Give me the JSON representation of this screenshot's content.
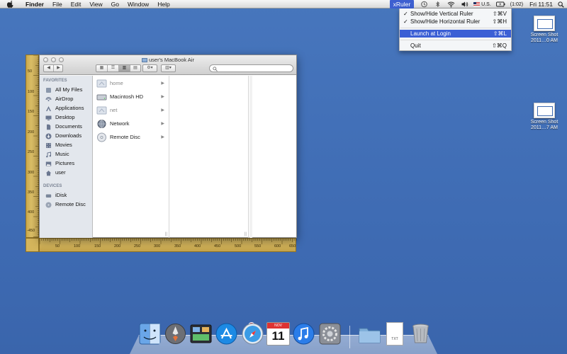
{
  "menubar": {
    "app_name": "Finder",
    "items": [
      "File",
      "Edit",
      "View",
      "Go",
      "Window",
      "Help"
    ],
    "status": {
      "xruler_label": "xRuler",
      "input_source": "U.S.",
      "battery": "(1:02)",
      "clock": "Fri 11:51"
    }
  },
  "xruler_menu": {
    "items": [
      {
        "label": "Show/Hide Vertical Ruler",
        "shortcut": "⇧⌘V",
        "checked": true
      },
      {
        "label": "Show/Hide Horizontal Ruler",
        "shortcut": "⇧⌘H",
        "checked": true
      },
      {
        "label": "Launch at Login",
        "shortcut": "⇧⌘L",
        "highlighted": true
      },
      {
        "label": "Quit",
        "shortcut": "⇧⌘Q"
      }
    ],
    "check_glyph": "✓"
  },
  "desktop_icons": [
    {
      "label_line1": "Screen Shot",
      "label_line2": "2011…0 AM"
    },
    {
      "label_line1": "Screen Shot",
      "label_line2": "2011…7 AM"
    }
  ],
  "vertical_ruler": {
    "labels": [
      "50",
      "100",
      "150",
      "200",
      "250",
      "300",
      "350",
      "400",
      "-450"
    ]
  },
  "horizontal_ruler": {
    "labels": [
      "50",
      "100",
      "150",
      "200",
      "250",
      "300",
      "350",
      "400",
      "450",
      "500",
      "550",
      "600",
      "650"
    ]
  },
  "finder": {
    "title": "user's MacBook Air",
    "search_placeholder": "",
    "sidebar": {
      "favorites_header": "FAVORITES",
      "favorites": [
        {
          "label": "All My Files",
          "icon": "all-files-icon"
        },
        {
          "label": "AirDrop",
          "icon": "airdrop-icon"
        },
        {
          "label": "Applications",
          "icon": "applications-icon"
        },
        {
          "label": "Desktop",
          "icon": "desktop-icon"
        },
        {
          "label": "Documents",
          "icon": "documents-icon"
        },
        {
          "label": "Downloads",
          "icon": "downloads-icon"
        },
        {
          "label": "Movies",
          "icon": "movies-icon"
        },
        {
          "label": "Music",
          "icon": "music-icon"
        },
        {
          "label": "Pictures",
          "icon": "pictures-icon"
        },
        {
          "label": "user",
          "icon": "home-icon"
        }
      ],
      "devices_header": "DEVICES",
      "devices": [
        {
          "label": "iDisk",
          "icon": "idisk-icon"
        },
        {
          "label": "Remote Disc",
          "icon": "remote-disc-icon"
        }
      ]
    },
    "column1": [
      {
        "label": "home",
        "dim": true
      },
      {
        "label": "Macintosh HD",
        "dim": false
      },
      {
        "label": "net",
        "dim": true
      },
      {
        "label": "Network",
        "dim": false
      },
      {
        "label": "Remote Disc",
        "dim": false
      }
    ]
  },
  "dock": {
    "items": [
      "Finder",
      "Launchpad",
      "Mission Control",
      "App Store",
      "Safari",
      "iCal",
      "iTunes",
      "System Preferences",
      "Applications",
      "Documents",
      "Trash"
    ],
    "app_store_badge": "9",
    "ical_month": "NOV",
    "ical_day": "11",
    "doc_label": "TXT"
  }
}
